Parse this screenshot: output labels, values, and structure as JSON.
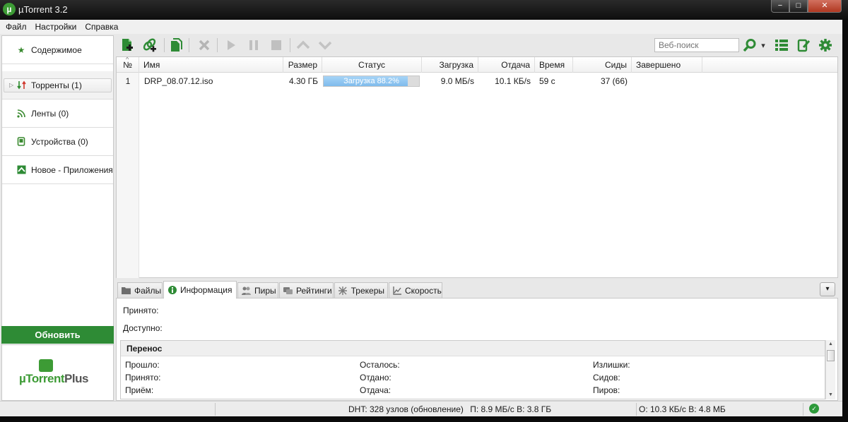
{
  "window": {
    "title": "µTorrent 3.2",
    "app_icon_glyph": "µ",
    "controls": {
      "minimize": "−",
      "maximize": "□",
      "close": "✕"
    }
  },
  "menu": {
    "items": [
      "Файл",
      "Настройки",
      "Справка"
    ]
  },
  "sidebar": {
    "items": [
      {
        "label": "Содержимое",
        "icon": "star-icon"
      },
      {
        "label": "Торренты (1)",
        "icon": "torrents-icon"
      },
      {
        "label": "Ленты (0)",
        "icon": "rss-icon"
      },
      {
        "label": "Устройства (0)",
        "icon": "device-icon"
      },
      {
        "label": "Новое - Приложения",
        "icon": "apps-icon"
      }
    ],
    "upgrade_label": "Обновить",
    "plus_logo": {
      "brand": "µTorrent",
      "suffix": "Plus"
    }
  },
  "toolbar": {
    "search_placeholder": "Веб-поиск",
    "dropdown_glyph": "▾"
  },
  "torrent_list": {
    "sort_glyph": "^",
    "columns": [
      "№",
      "Имя",
      "Размер",
      "Статус",
      "Загрузка",
      "Отдача",
      "Время",
      "Сиды",
      "Завершено"
    ],
    "rows": [
      {
        "num": "1",
        "name": "DRP_08.07.12.iso",
        "size": "4.30 ГБ",
        "status": "Загрузка 88.2%",
        "progress_pct": 88.2,
        "download": "9.0 МБ/s",
        "upload": "10.1 КБ/s",
        "time": "59 с",
        "seeds": "37 (66)",
        "completed": ""
      }
    ]
  },
  "detail_tabs": {
    "tabs": [
      "Файлы",
      "Информация",
      "Пиры",
      "Рейтинги",
      "Трекеры",
      "Скорость"
    ],
    "active": "Информация",
    "collapse_glyph": "▾"
  },
  "info": {
    "received_label": "Принято:",
    "available_label": "Доступно:",
    "transfer_title": "Перенос",
    "transfer_labels": {
      "col1": [
        "Прошло:",
        "Принято:",
        "Приём:"
      ],
      "col2": [
        "Осталось:",
        "Отдано:",
        "Отдача:"
      ],
      "col3": [
        "Излишки:",
        "Сидов:",
        "Пиров:"
      ]
    }
  },
  "statusbar": {
    "dht": "DHT: 328 узлов  (обновление)",
    "download_summary": "П: 8.9 МБ/с В: 3.8 ГБ",
    "upload_summary": "О: 10.3 КБ/с В: 4.8 МБ",
    "ok_glyph": "✓"
  },
  "colors": {
    "accent_green": "#2e8b35",
    "progress_fill": "#8cc4f0"
  }
}
